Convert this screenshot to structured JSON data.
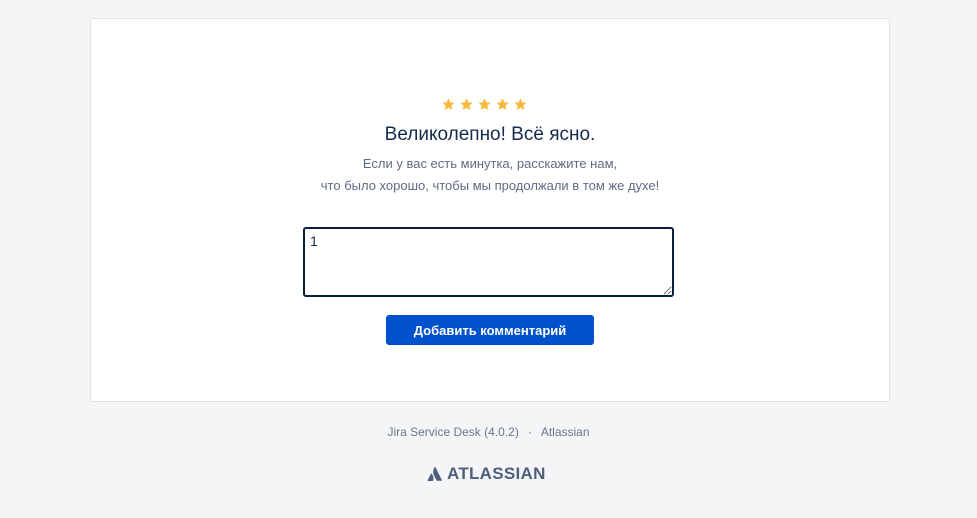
{
  "rating": {
    "stars_filled": 5,
    "stars_total": 5,
    "star_color": "#f6b93b"
  },
  "feedback": {
    "headline": "Великолепно! Всё ясно.",
    "prompt_line1": "Если у вас есть минутка, расскажите нам,",
    "prompt_line2": "что было хорошо, чтобы мы продолжали в том же духе!",
    "comment_value": "1",
    "submit_label": "Добавить комментарий",
    "accent_color": "#0052cc"
  },
  "footer": {
    "product": "Jira Service Desk (4.0.2)",
    "separator": "·",
    "company_link": "Atlassian",
    "logo_text": "ATLASSIAN",
    "logo_icon": "atlassian-logo-icon"
  }
}
